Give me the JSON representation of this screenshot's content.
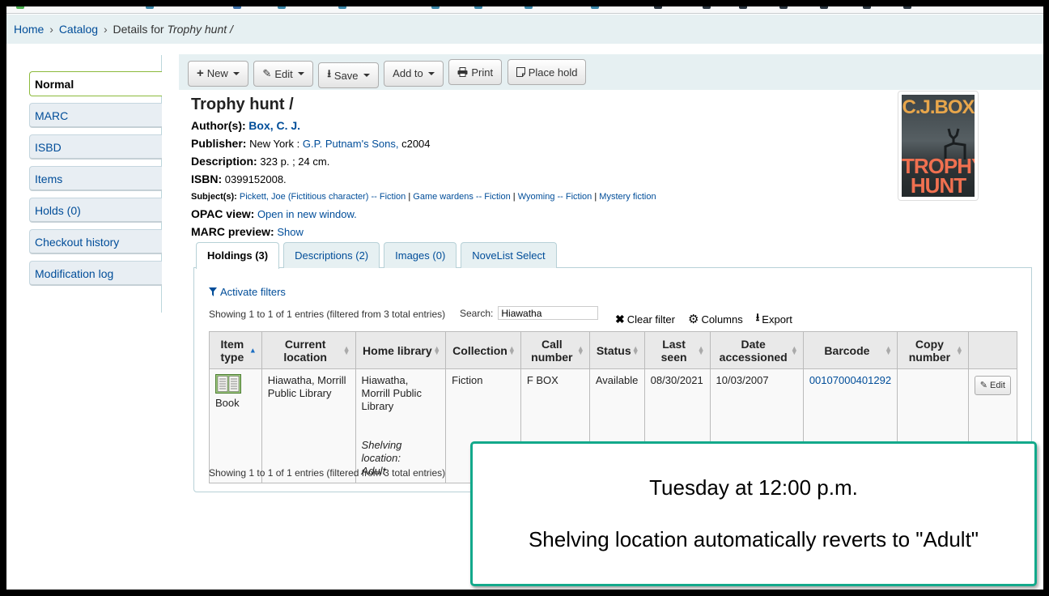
{
  "breadcrumb": {
    "home": "Home",
    "catalog": "Catalog",
    "details_prefix": "Details for",
    "title": "Trophy hunt /",
    "separator": "›"
  },
  "sidebar": {
    "items": [
      {
        "label": "Normal",
        "active": true
      },
      {
        "label": "MARC"
      },
      {
        "label": "ISBD"
      },
      {
        "label": "Items"
      },
      {
        "label": "Holds (0)"
      },
      {
        "label": "Checkout history"
      },
      {
        "label": "Modification log"
      }
    ]
  },
  "toolbar": {
    "new": "New",
    "edit": "Edit",
    "save": "Save",
    "add_to": "Add to",
    "print": "Print",
    "place_hold": "Place hold"
  },
  "record": {
    "title": "Trophy hunt /",
    "author_label": "Author(s):",
    "author": "Box, C. J.",
    "publisher_label": "Publisher:",
    "publisher_place": "New York :",
    "publisher_name": "G.P. Putnam's Sons,",
    "publisher_date": "c2004",
    "description_label": "Description:",
    "description": "323 p. ; 24 cm.",
    "isbn_label": "ISBN:",
    "isbn": "0399152008.",
    "subjects_label": "Subject(s):",
    "subjects": [
      "Pickett, Joe (Fictitious character) -- Fiction",
      "Game wardens -- Fiction",
      "Wyoming -- Fiction",
      "Mystery fiction"
    ],
    "opac_label": "OPAC view:",
    "opac_link": "Open in new window.",
    "marc_label": "MARC preview:",
    "marc_link": "Show"
  },
  "cover": {
    "author_text": "C.J.BOX",
    "title_line1": "TROPHY",
    "title_line2": "HUNT"
  },
  "tabs": [
    {
      "label": "Holdings (3)",
      "active": true
    },
    {
      "label": "Descriptions (2)"
    },
    {
      "label": "Images (0)"
    },
    {
      "label": "NoveList Select"
    }
  ],
  "holdings": {
    "activate_filters": "Activate filters",
    "info": "Showing 1 to 1 of 1 entries (filtered from 3 total entries)",
    "search_label": "Search:",
    "search_value": "Hiawatha",
    "clear_filter": "Clear filter",
    "columns": "Columns",
    "export": "Export",
    "headers": [
      "Item type",
      "Current location",
      "Home library",
      "Collection",
      "Call number",
      "Status",
      "Last seen",
      "Date accessioned",
      "Barcode",
      "Copy number",
      ""
    ],
    "rows": [
      {
        "item_type": "Book",
        "current_location": "Hiawatha, Morrill Public Library",
        "home_library": "Hiawatha, Morrill Public Library",
        "shelving_label": "Shelving location:",
        "shelving_value": "Adult",
        "collection": "Fiction",
        "call_number": "F BOX",
        "status": "Available",
        "last_seen": "08/30/2021",
        "date_accessioned": "10/03/2007",
        "barcode": "00107000401292",
        "copy_number": "",
        "edit": "Edit"
      }
    ]
  },
  "callout": {
    "line1": "Tuesday at 12:00 p.m.",
    "line2": "Shelving location automatically reverts to \"Adult\"",
    "border_color": "#13a98b"
  }
}
